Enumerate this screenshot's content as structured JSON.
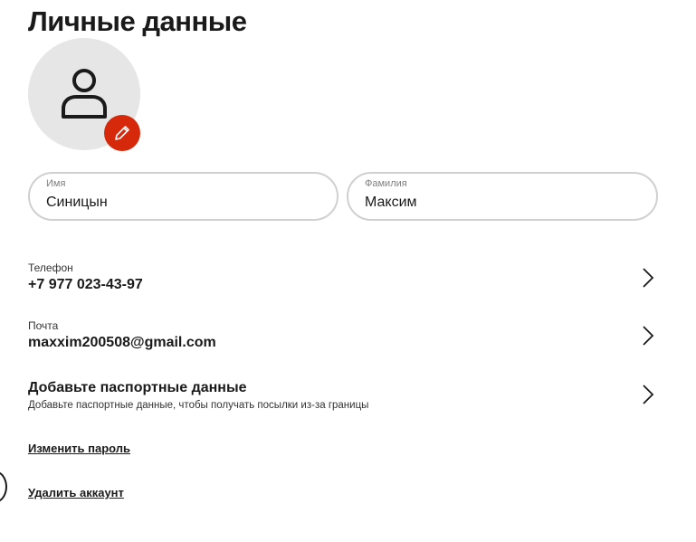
{
  "page": {
    "title": "Личные данные"
  },
  "avatar": {
    "icon": "user-icon",
    "edit_icon": "pencil-icon",
    "edit_color": "#d6280b"
  },
  "fields": {
    "first_name": {
      "label": "Имя",
      "value": "Синицын"
    },
    "last_name": {
      "label": "Фамилия",
      "value": "Максим"
    }
  },
  "rows": {
    "phone": {
      "label": "Телефон",
      "value": "+7 977 023-43-97"
    },
    "email": {
      "label": "Почта",
      "value": "maxxim200508@gmail.com"
    },
    "passport": {
      "title": "Добавьте паспортные данные",
      "subtitle": "Добавьте паспортные данные, чтобы получать посылки из-за границы"
    }
  },
  "links": {
    "change_password": "Изменить пароль",
    "delete_account": "Удалить аккаунт"
  }
}
